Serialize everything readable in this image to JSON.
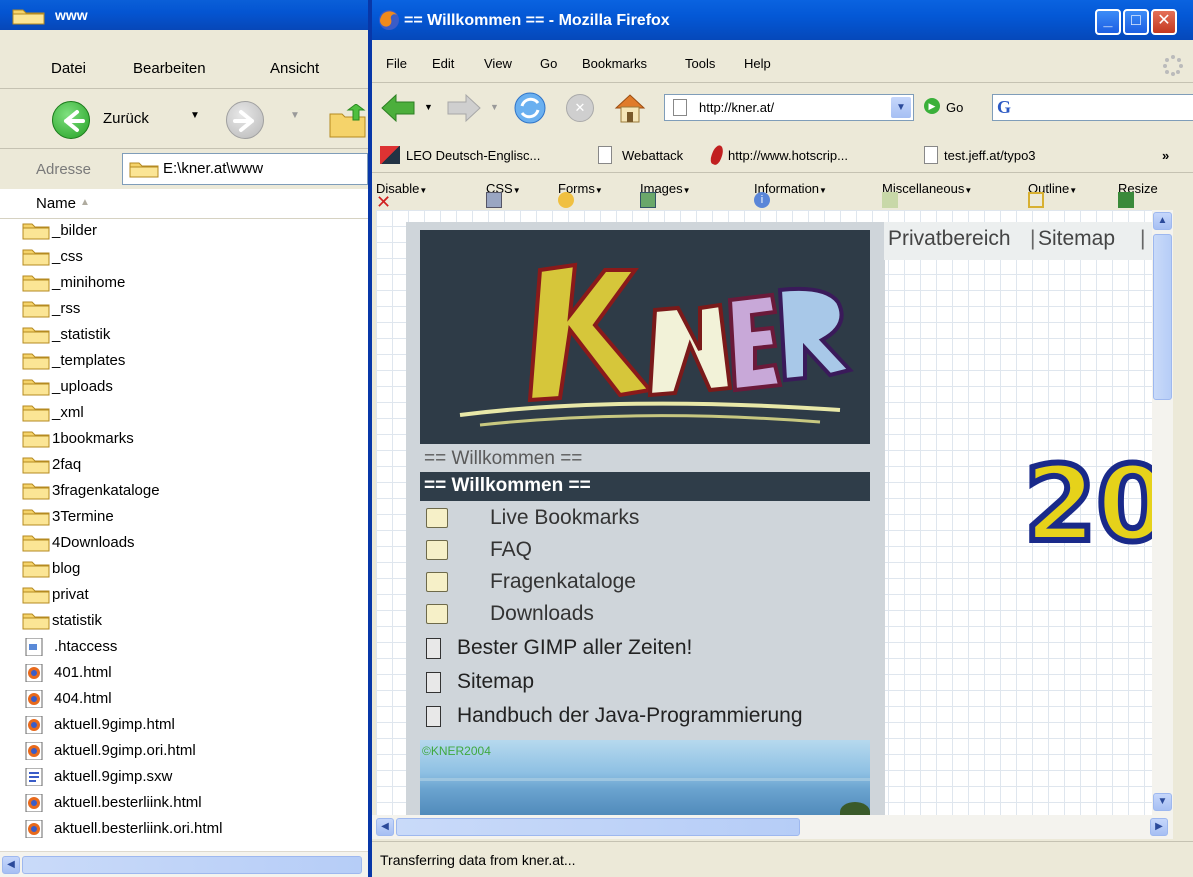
{
  "explorer": {
    "title": "www",
    "menu": {
      "file": "Datei",
      "edit": "Bearbeiten",
      "view": "Ansicht"
    },
    "toolbar": {
      "back_label": "Zurück"
    },
    "address": {
      "label": "Adresse",
      "value": "E:\\kner.at\\www"
    },
    "column_header": "Name",
    "items": [
      {
        "name": "_bilder",
        "type": "folder"
      },
      {
        "name": "_css",
        "type": "folder"
      },
      {
        "name": "_minihome",
        "type": "folder"
      },
      {
        "name": "_rss",
        "type": "folder"
      },
      {
        "name": "_statistik",
        "type": "folder"
      },
      {
        "name": "_templates",
        "type": "folder"
      },
      {
        "name": "_uploads",
        "type": "folder"
      },
      {
        "name": "_xml",
        "type": "folder"
      },
      {
        "name": "1bookmarks",
        "type": "folder"
      },
      {
        "name": "2faq",
        "type": "folder"
      },
      {
        "name": "3fragenkataloge",
        "type": "folder"
      },
      {
        "name": "3Termine",
        "type": "folder"
      },
      {
        "name": "4Downloads",
        "type": "folder"
      },
      {
        "name": "blog",
        "type": "folder"
      },
      {
        "name": "privat",
        "type": "folder"
      },
      {
        "name": "statistik",
        "type": "folder"
      },
      {
        "name": ".htaccess",
        "type": "file"
      },
      {
        "name": "401.html",
        "type": "html"
      },
      {
        "name": "404.html",
        "type": "html"
      },
      {
        "name": "aktuell.9gimp.html",
        "type": "html"
      },
      {
        "name": "aktuell.9gimp.ori.html",
        "type": "html"
      },
      {
        "name": "aktuell.9gimp.sxw",
        "type": "doc"
      },
      {
        "name": "aktuell.besterliink.html",
        "type": "html"
      },
      {
        "name": "aktuell.besterliink.ori.html",
        "type": "html"
      }
    ]
  },
  "firefox": {
    "title": "== Willkommen == - Mozilla Firefox",
    "menu": [
      "File",
      "Edit",
      "View",
      "Go",
      "Bookmarks",
      "Tools",
      "Help"
    ],
    "url": "http://kner.at/",
    "go_label": "Go",
    "bookmarks": [
      "LEO Deutsch-Englisc...",
      "Webattack",
      "http://www.hotscrip...",
      "test.jeff.at/typo3"
    ],
    "bookmarks_more": "»",
    "devbar": [
      "Disable",
      "CSS",
      "Forms",
      "Images",
      "Information",
      "Miscellaneous",
      "Outline",
      "Resize"
    ],
    "status": "Transferring data from kner.at...",
    "page": {
      "logo_text": "KNER",
      "plain_title": "== Willkommen ==",
      "active_title": "== Willkommen ==",
      "folders": [
        "Live Bookmarks",
        "FAQ",
        "Fragenkataloge",
        "Downloads"
      ],
      "docs": [
        "Bester GIMP aller Zeiten!",
        "Sitemap",
        "Handbuch der Java-Programmierung"
      ],
      "copyright": "©KNER2004",
      "right_nav": [
        "Privatbereich",
        "Sitemap"
      ],
      "year_fragment": "20"
    }
  },
  "colors": {
    "xp_title_blue": "#0458d6",
    "page_dark": "#2f3d49",
    "page_panel": "#cfd5da"
  }
}
